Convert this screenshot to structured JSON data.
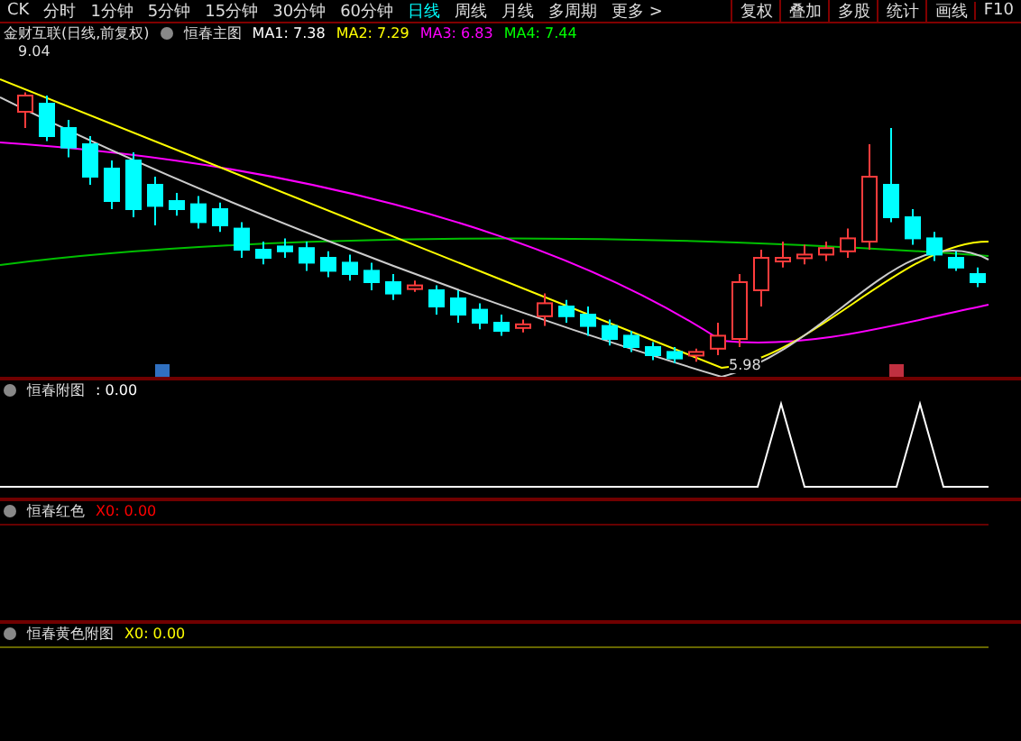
{
  "toolbar": {
    "code": "CK",
    "periods": [
      {
        "label": "分时",
        "selected": false
      },
      {
        "label": "1分钟",
        "selected": false
      },
      {
        "label": "5分钟",
        "selected": false
      },
      {
        "label": "15分钟",
        "selected": false
      },
      {
        "label": "30分钟",
        "selected": false
      },
      {
        "label": "60分钟",
        "selected": false
      },
      {
        "label": "日线",
        "selected": true
      },
      {
        "label": "周线",
        "selected": false
      },
      {
        "label": "月线",
        "selected": false
      },
      {
        "label": "多周期",
        "selected": false
      },
      {
        "label": "更多 >",
        "selected": false
      }
    ],
    "actions": [
      "复权",
      "叠加",
      "多股",
      "统计",
      "画线",
      "F10"
    ]
  },
  "main_chart": {
    "title": "金财互联(日线,前复权)",
    "indicator": "恒春主图",
    "ma": [
      {
        "label": "MA1: 7.38",
        "color": "#ffffff"
      },
      {
        "label": "MA2: 7.29",
        "color": "#ffff00"
      },
      {
        "label": "MA3: 6.83",
        "color": "#ff00ff"
      },
      {
        "label": "MA4: 7.44",
        "color": "#00ff00"
      }
    ],
    "high_label": "9.04",
    "low_label": "5.98"
  },
  "panels": [
    {
      "name": "恒春附图",
      "reading": ": 0.00",
      "color": "#ffffff",
      "kind": "spikes"
    },
    {
      "name": "恒春红色",
      "reading": "X0: 0.00",
      "color": "#ff0000",
      "kind": "flat"
    },
    {
      "name": "恒春黄色附图",
      "reading": "X0: 0.00",
      "color": "#ffff00",
      "kind": "flat"
    }
  ]
}
